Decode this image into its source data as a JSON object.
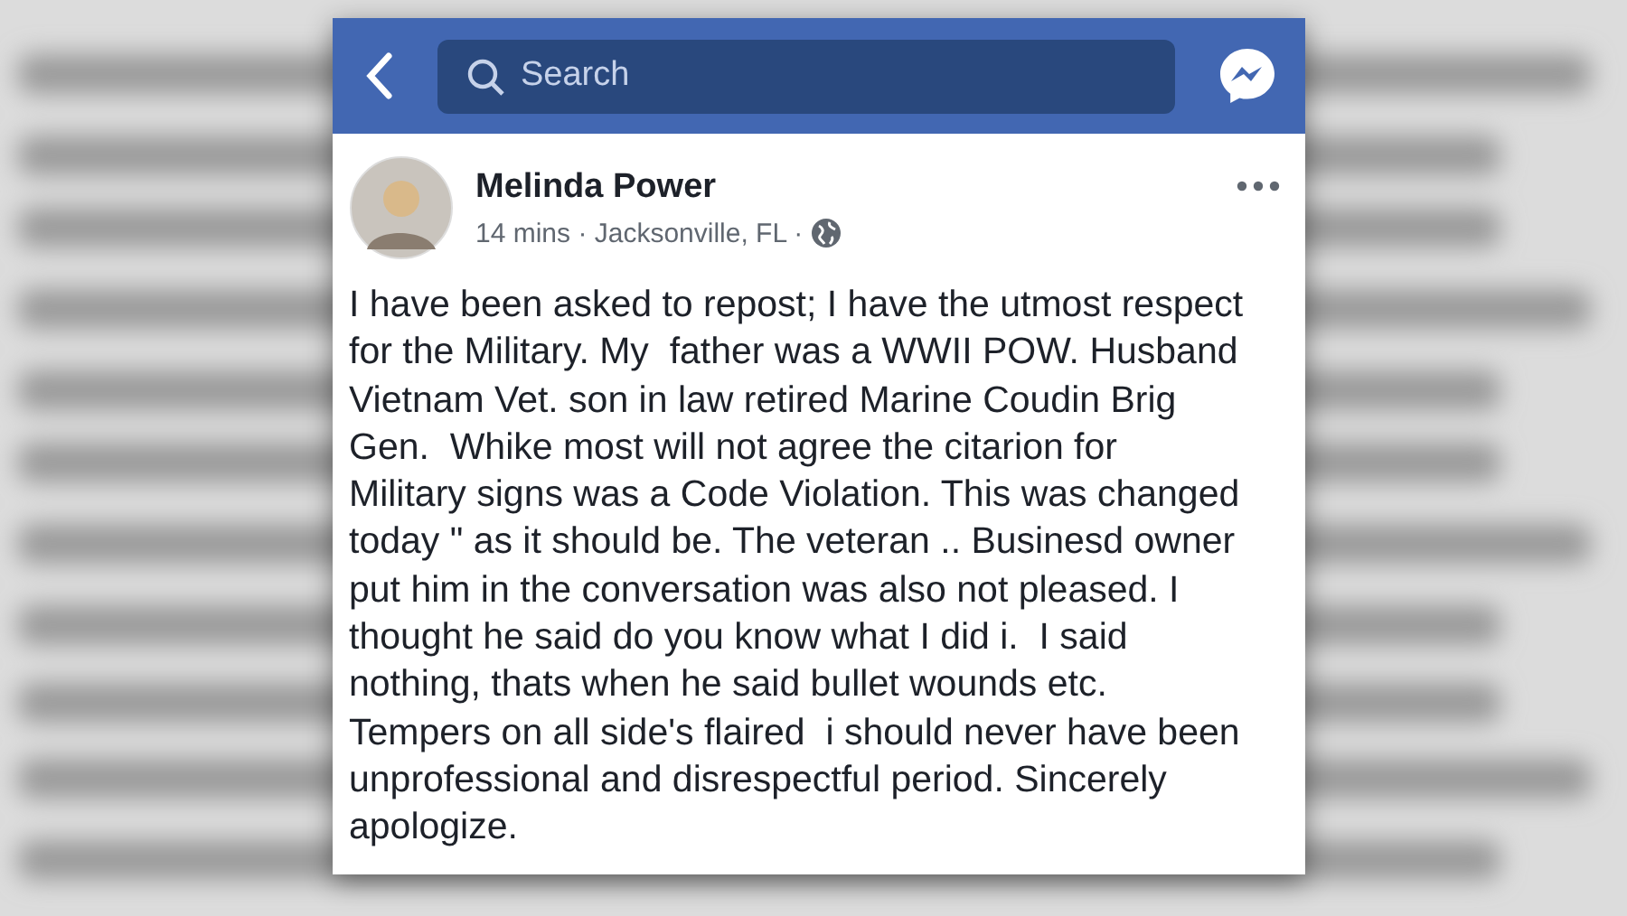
{
  "header": {
    "search": {
      "placeholder": "Search"
    }
  },
  "post": {
    "author": "Melinda Power",
    "meta": "14 mins · Jacksonville, FL ·",
    "text": "I have been asked to repost; I have the utmost respect\nfor the Military. My  father was a WWII POW. Husband\nVietnam Vet. son in law retired Marine Coudin Brig\nGen.  Whike most will not agree the citarion for\nMilitary signs was a Code Violation. This was changed\ntoday \" as it should be. The veteran .. Businesd owner\nput him in the conversation was also not pleased. I\nthought he said do you know what I did i.  I said\nnothing, thats when he said bullet wounds etc.\nTempers on all side's flaired  i should never have been\nunprofessional and disrespectful period. Sincerely\napologize."
  }
}
